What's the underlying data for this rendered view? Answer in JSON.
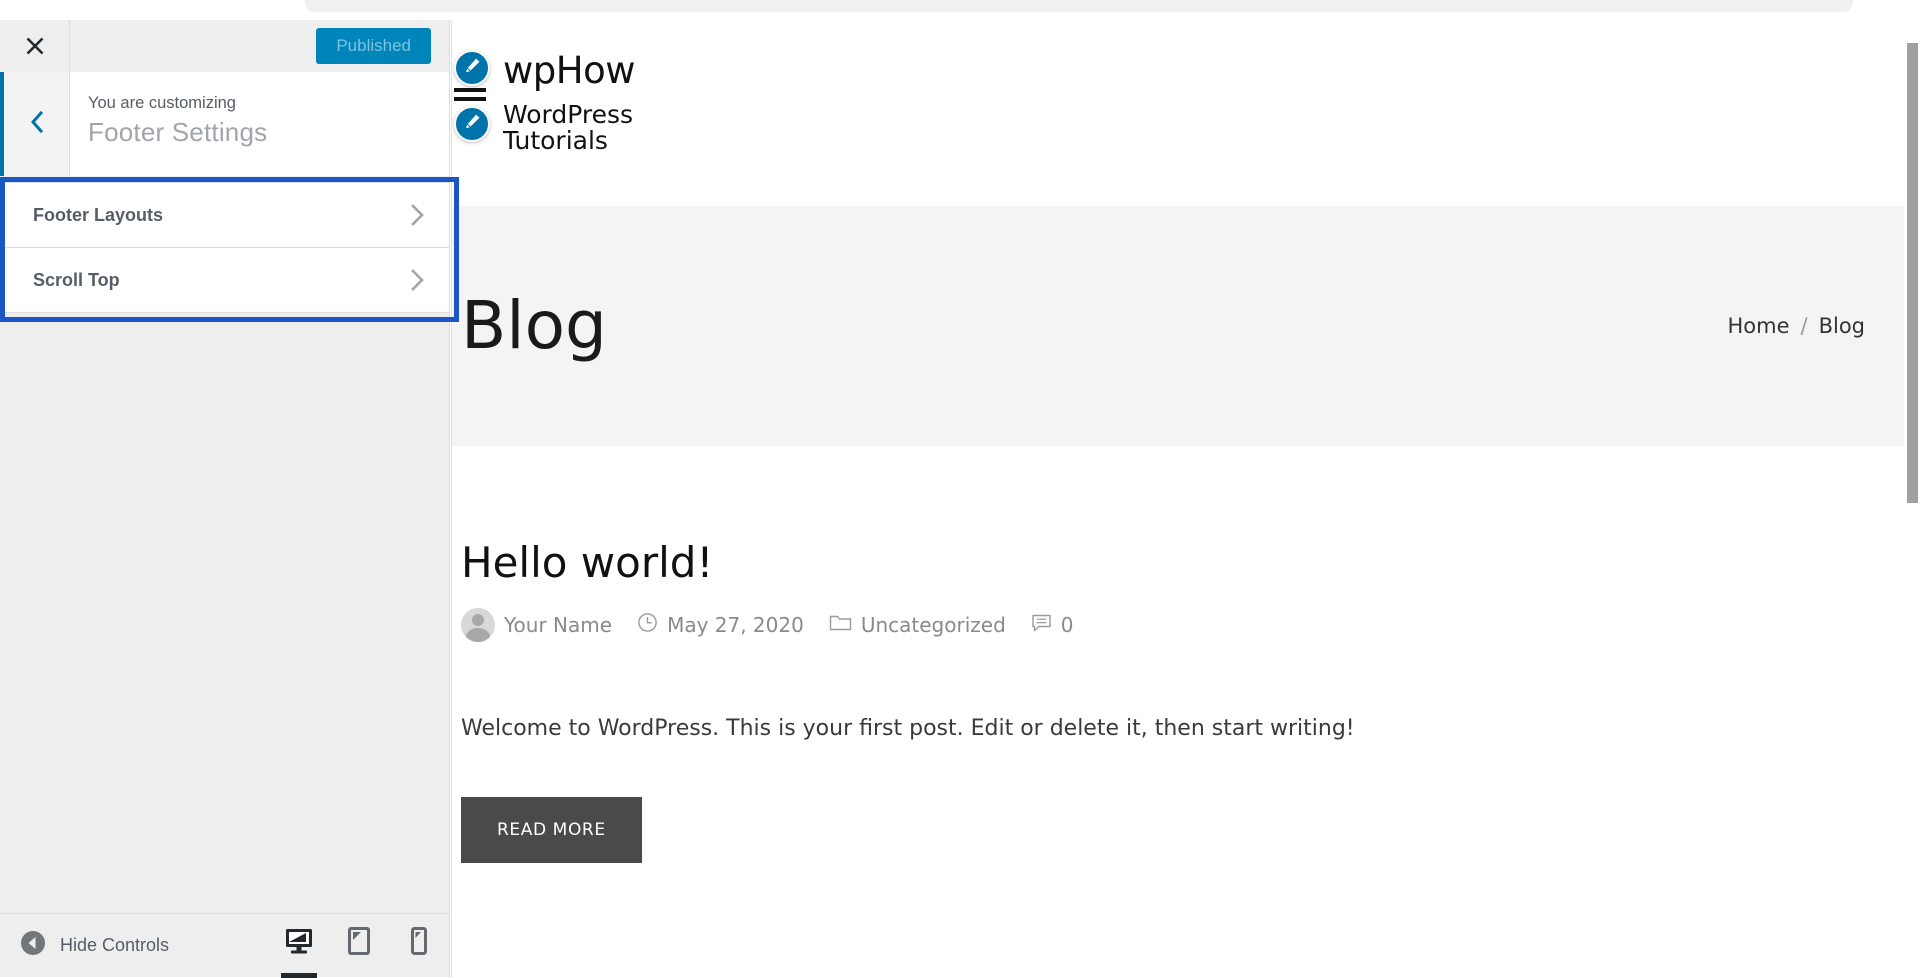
{
  "customizer": {
    "close_icon": "close-x-icon",
    "publish_label": "Published",
    "back_icon": "chevron-left-icon",
    "supertitle": "You are customizing",
    "title": "Footer Settings",
    "sections": [
      {
        "label": "Footer Layouts",
        "chevron": "chevron-right-icon"
      },
      {
        "label": "Scroll Top",
        "chevron": "chevron-right-icon"
      }
    ],
    "footer": {
      "hide_controls_label": "Hide Controls",
      "hide_controls_icon": "collapse-arrow-left-icon",
      "devices": [
        {
          "name": "desktop",
          "icon": "desktop-icon",
          "active": true
        },
        {
          "name": "tablet",
          "icon": "tablet-icon",
          "active": false
        },
        {
          "name": "mobile",
          "icon": "mobile-icon",
          "active": false
        }
      ]
    },
    "highlight_color": "#1a56c4",
    "accent_color": "#0073aa",
    "publish_bg": "#0085ba"
  },
  "preview": {
    "site": {
      "title": "wpHow",
      "description": "WordPress Tutorials",
      "edit_shortcut_icon": "pencil-edit-icon",
      "menu_toggle_icon": "hamburger-menu-icon"
    },
    "hero": {
      "title": "Blog",
      "breadcrumb": {
        "home": "Home",
        "separator": "/",
        "current": "Blog"
      }
    },
    "post": {
      "title": "Hello world!",
      "author": "Your Name",
      "author_icon": "avatar-icon",
      "date": "May 27, 2020",
      "date_icon": "clock-icon",
      "category": "Uncategorized",
      "category_icon": "folder-icon",
      "comment_count": "0",
      "comment_icon": "comment-bubble-icon",
      "excerpt": "Welcome to WordPress. This is your first post. Edit or delete it, then start writing!",
      "read_more_label": "READ MORE"
    }
  }
}
